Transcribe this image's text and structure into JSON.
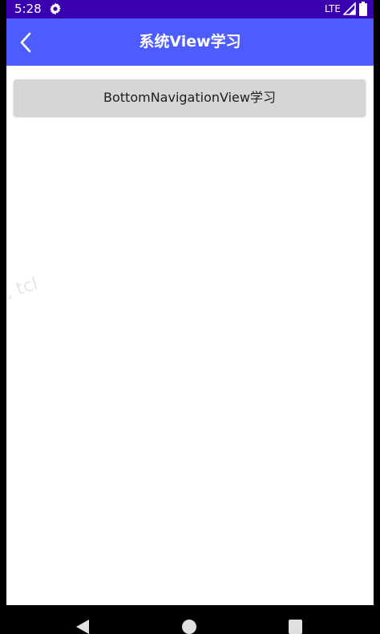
{
  "status_bar": {
    "time": "5:28",
    "network": "LTE",
    "settings_icon": "gear-icon",
    "signal_icon": "signal-icon",
    "battery_icon": "battery-icon"
  },
  "app_bar": {
    "title": "系统View学习",
    "back_icon": "chevron-left-icon",
    "color": "#4d5cfe"
  },
  "main": {
    "button_label": "BottomNavigationView学习"
  },
  "watermark": {
    "text": "l, tcl"
  },
  "nav_bar": {
    "back_icon": "triangle-back-icon",
    "home_icon": "circle-home-icon",
    "recents_icon": "square-recents-icon"
  },
  "colors": {
    "status_bar": "#3a00b0",
    "app_bar": "#4d5cfe",
    "button": "#d6d6d8"
  }
}
